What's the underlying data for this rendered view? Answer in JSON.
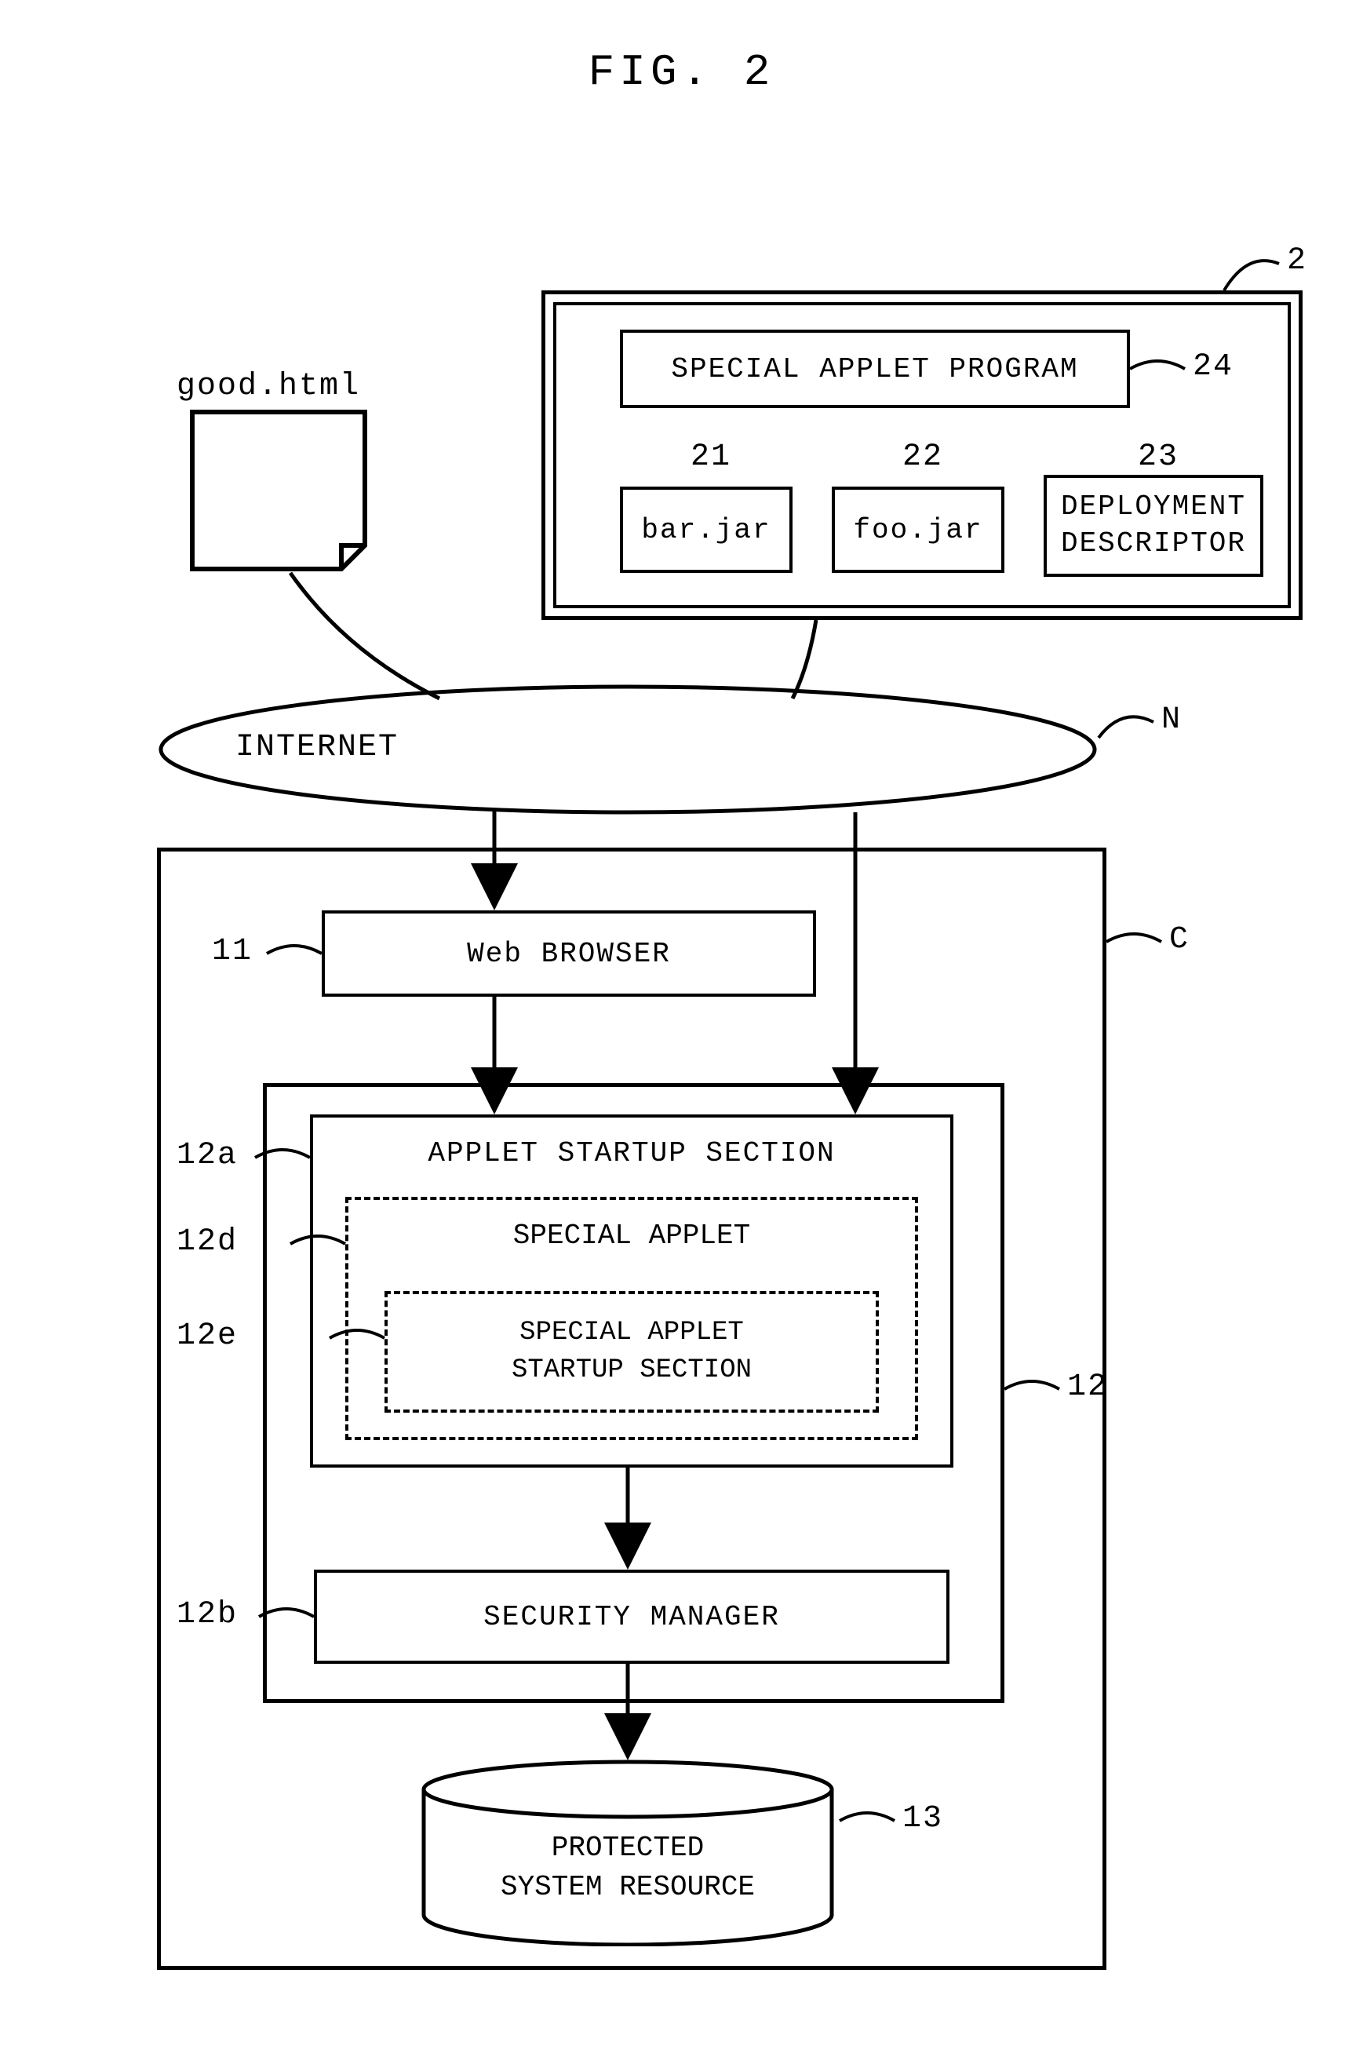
{
  "figure_title": "FIG. 2",
  "html_file_label": "good.html",
  "server": {
    "ref": "2",
    "special_applet_program": {
      "label": "SPECIAL APPLET PROGRAM",
      "ref": "24"
    },
    "bar_jar": {
      "label": "bar.jar",
      "ref": "21"
    },
    "foo_jar": {
      "label": "foo.jar",
      "ref": "22"
    },
    "deployment_descriptor": {
      "label": "DEPLOYMENT\nDESCRIPTOR",
      "ref": "23"
    }
  },
  "network": {
    "label": "INTERNET",
    "ref": "N"
  },
  "client": {
    "ref": "C",
    "web_browser": {
      "label": "Web BROWSER",
      "ref": "11"
    },
    "jvm": {
      "ref": "12",
      "applet_startup": {
        "label": "APPLET STARTUP SECTION",
        "ref": "12a"
      },
      "special_applet": {
        "label": "SPECIAL APPLET",
        "ref": "12d"
      },
      "special_applet_startup": {
        "label": "SPECIAL APPLET\nSTARTUP SECTION",
        "ref": "12e"
      },
      "security_manager": {
        "label": "SECURITY MANAGER",
        "ref": "12b"
      }
    },
    "protected_resource": {
      "label": "PROTECTED\nSYSTEM RESOURCE",
      "ref": "13"
    }
  }
}
